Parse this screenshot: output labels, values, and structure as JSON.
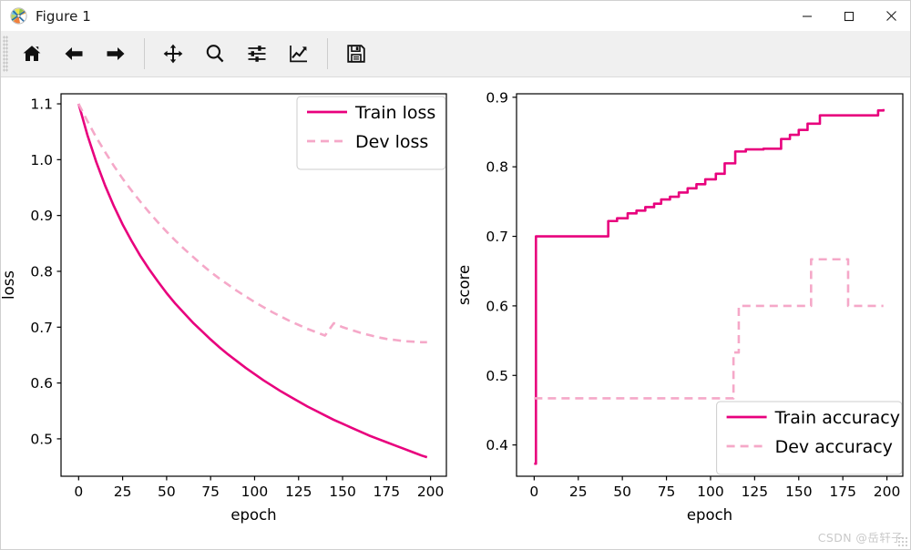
{
  "window": {
    "title": "Figure 1",
    "icon": "matplotlib-logo-icon",
    "controls": {
      "minimize": "—",
      "maximize": "☐",
      "close": "✕"
    }
  },
  "toolbar": {
    "buttons": [
      {
        "name": "home-icon",
        "tooltip": "Reset original view"
      },
      {
        "name": "arrow-left-icon",
        "tooltip": "Back to previous view"
      },
      {
        "name": "arrow-right-icon",
        "tooltip": "Forward to next view"
      },
      {
        "name": "pan-icon",
        "tooltip": "Pan axes with left mouse, zoom with right"
      },
      {
        "name": "zoom-icon",
        "tooltip": "Zoom to rectangle"
      },
      {
        "name": "sliders-icon",
        "tooltip": "Configure subplots"
      },
      {
        "name": "curve-edit-icon",
        "tooltip": "Edit axis, curve and image parameters"
      },
      {
        "name": "save-icon",
        "tooltip": "Save the figure"
      }
    ]
  },
  "watermark": "CSDN @岳轩子",
  "colors": {
    "train": "#e8007d",
    "dev": "#f5a8c8",
    "axis": "#000000",
    "text": "#000000",
    "legend_border": "#cccccc",
    "background": "#ffffff"
  },
  "chart_data": [
    {
      "id": "loss-plot",
      "type": "line",
      "title": "",
      "xlabel": "epoch",
      "ylabel": "loss",
      "xlim": [
        -10,
        209
      ],
      "ylim": [
        0.433,
        1.118
      ],
      "xticks": [
        0,
        25,
        50,
        75,
        100,
        125,
        150,
        175,
        200
      ],
      "xticklabels": [
        "0",
        "25",
        "50",
        "75",
        "100",
        "125",
        "150",
        "175",
        "200"
      ],
      "yticks": [
        0.5,
        0.6,
        0.7,
        0.8,
        0.9,
        1.0,
        1.1
      ],
      "yticklabels": [
        "0.5",
        "0.6",
        "0.7",
        "0.8",
        "0.9",
        "1.0",
        "1.1"
      ],
      "grid": false,
      "legend_position": "upper right",
      "series": [
        {
          "name": "Train loss",
          "style": "solid",
          "color": "#e8007d",
          "x": [
            0,
            5,
            10,
            15,
            20,
            25,
            30,
            35,
            40,
            45,
            50,
            55,
            60,
            65,
            70,
            75,
            80,
            85,
            90,
            95,
            100,
            105,
            110,
            115,
            120,
            125,
            130,
            135,
            140,
            145,
            150,
            155,
            160,
            165,
            170,
            175,
            180,
            185,
            190,
            195,
            198
          ],
          "values": [
            1.1,
            1.044,
            0.996,
            0.954,
            0.917,
            0.884,
            0.855,
            0.828,
            0.804,
            0.782,
            0.761,
            0.742,
            0.725,
            0.708,
            0.693,
            0.678,
            0.664,
            0.651,
            0.639,
            0.627,
            0.616,
            0.605,
            0.595,
            0.585,
            0.576,
            0.567,
            0.558,
            0.55,
            0.542,
            0.534,
            0.527,
            0.52,
            0.513,
            0.506,
            0.5,
            0.494,
            0.488,
            0.482,
            0.476,
            0.47,
            0.467
          ]
        },
        {
          "name": "Dev loss",
          "style": "dashed",
          "color": "#f5a8c8",
          "x": [
            0,
            5,
            10,
            15,
            20,
            25,
            30,
            35,
            40,
            45,
            50,
            55,
            60,
            65,
            70,
            75,
            80,
            85,
            90,
            95,
            100,
            105,
            110,
            115,
            120,
            125,
            130,
            135,
            140,
            145,
            150,
            155,
            160,
            165,
            170,
            175,
            180,
            185,
            190,
            195,
            198
          ],
          "values": [
            1.1,
            1.069,
            1.04,
            1.014,
            0.989,
            0.966,
            0.945,
            0.925,
            0.906,
            0.888,
            0.871,
            0.855,
            0.84,
            0.826,
            0.812,
            0.799,
            0.787,
            0.776,
            0.765,
            0.755,
            0.745,
            0.736,
            0.727,
            0.719,
            0.711,
            0.704,
            0.697,
            0.691,
            0.685,
            0.707,
            0.7,
            0.695,
            0.69,
            0.686,
            0.682,
            0.679,
            0.677,
            0.675,
            0.674,
            0.673,
            0.673
          ]
        }
      ]
    },
    {
      "id": "accuracy-plot",
      "type": "line",
      "title": "",
      "xlabel": "epoch",
      "ylabel": "score",
      "xlim": [
        -10,
        209
      ],
      "ylim": [
        0.355,
        0.905
      ],
      "xticks": [
        0,
        25,
        50,
        75,
        100,
        125,
        150,
        175,
        200
      ],
      "xticklabels": [
        "0",
        "25",
        "50",
        "75",
        "100",
        "125",
        "150",
        "175",
        "200"
      ],
      "yticks": [
        0.4,
        0.5,
        0.6,
        0.7,
        0.8,
        0.9
      ],
      "yticklabels": [
        "0.4",
        "0.5",
        "0.6",
        "0.7",
        "0.8",
        "0.9"
      ],
      "grid": false,
      "legend_position": "lower right",
      "series": [
        {
          "name": "Train accuracy",
          "style": "solid",
          "color": "#e8007d",
          "x": [
            0,
            1,
            40,
            42,
            47,
            53,
            58,
            63,
            68,
            72,
            77,
            82,
            87,
            92,
            97,
            103,
            108,
            114,
            120,
            130,
            140,
            145,
            150,
            155,
            162,
            190,
            195,
            198
          ],
          "values": [
            0.373,
            0.7,
            0.7,
            0.722,
            0.726,
            0.733,
            0.737,
            0.742,
            0.747,
            0.753,
            0.757,
            0.763,
            0.769,
            0.775,
            0.782,
            0.79,
            0.805,
            0.822,
            0.825,
            0.826,
            0.84,
            0.846,
            0.853,
            0.862,
            0.874,
            0.874,
            0.881,
            0.883
          ]
        },
        {
          "name": "Dev accuracy",
          "style": "dashed",
          "color": "#f5a8c8",
          "x": [
            0,
            108,
            113,
            116,
            157,
            178,
            198
          ],
          "values": [
            0.467,
            0.467,
            0.533,
            0.6,
            0.667,
            0.6,
            0.6
          ]
        }
      ]
    }
  ]
}
